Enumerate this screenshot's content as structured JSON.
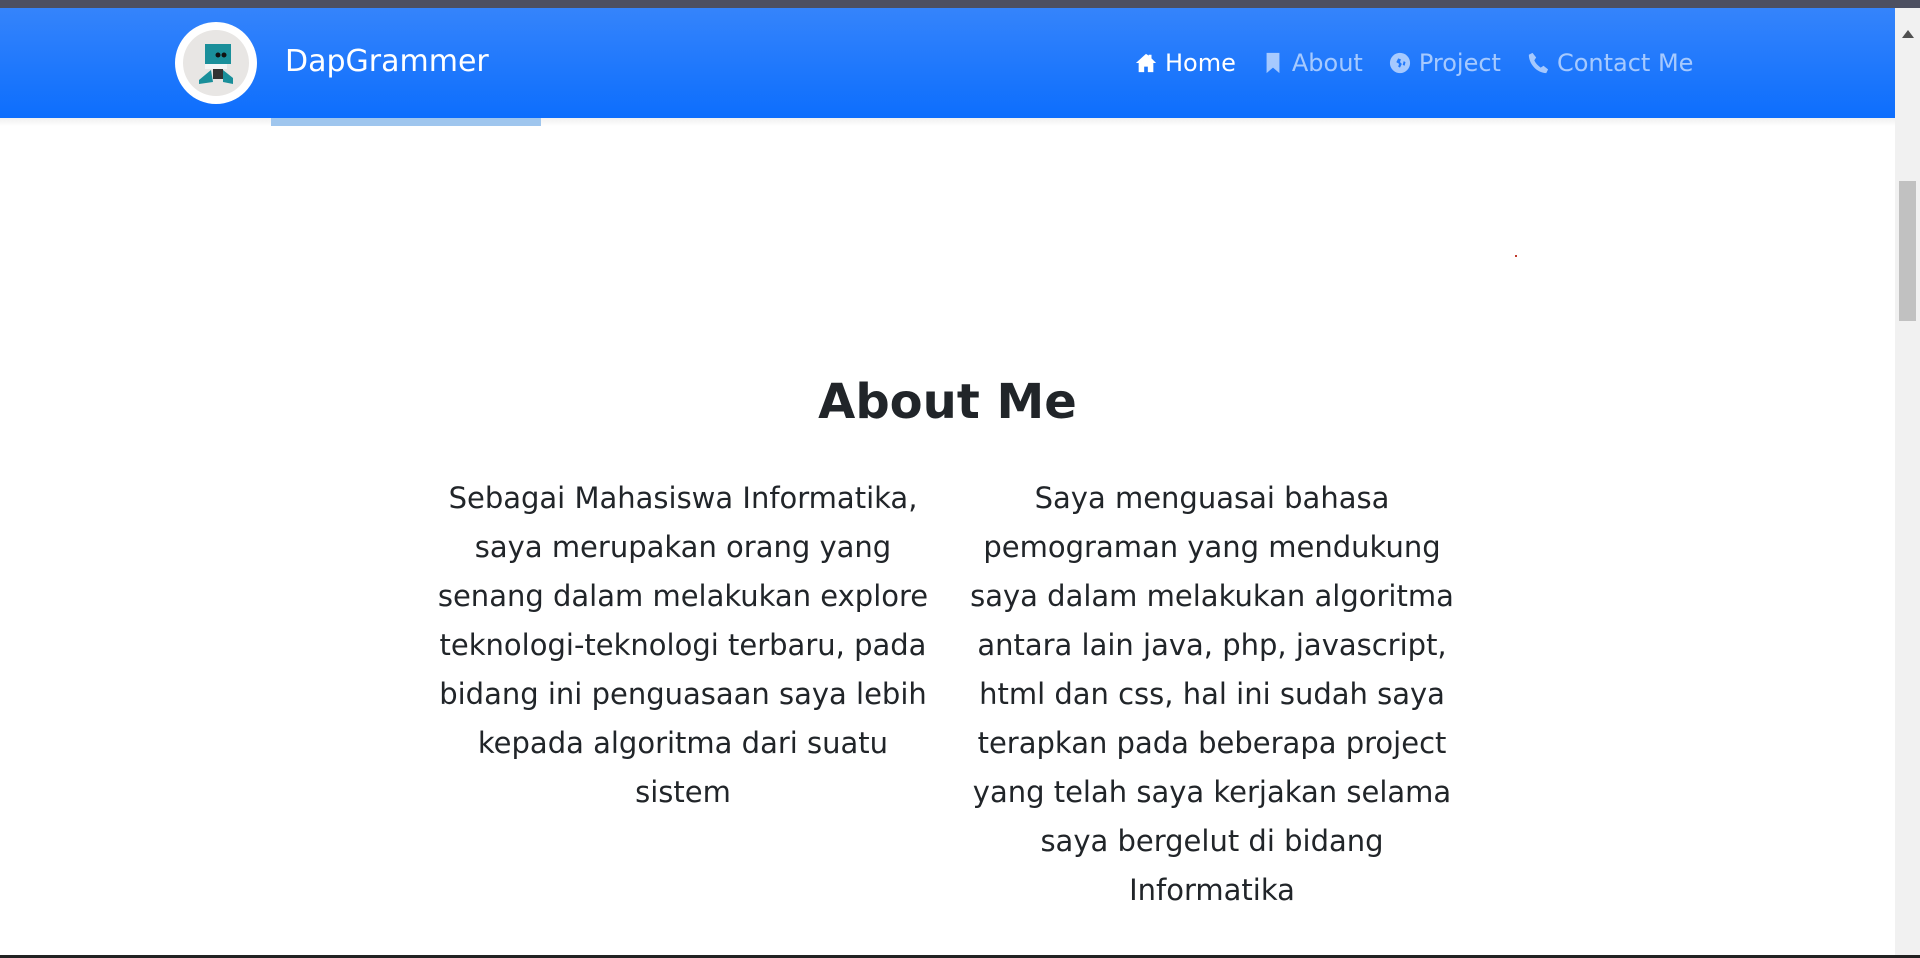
{
  "brand": {
    "name": "DapGrammer"
  },
  "nav": {
    "items": [
      {
        "label": "Home",
        "icon": "home-icon",
        "active": true
      },
      {
        "label": "About",
        "icon": "bookmark-icon",
        "active": false
      },
      {
        "label": "Project",
        "icon": "globe-icon",
        "active": false
      },
      {
        "label": "Contact Me",
        "icon": "phone-icon",
        "active": false
      }
    ]
  },
  "about": {
    "title": "About Me",
    "paragraph_left": "Sebagai Mahasiswa Informatika, saya merupakan orang yang senang dalam melakukan explore teknologi-teknologi terbaru, pada bidang ini penguasaan saya lebih kepada algoritma dari suatu sistem",
    "paragraph_right": "Saya menguasai bahasa pemograman yang mendukung saya dalam melakukan algoritma antara lain java, php, javascript, html dan css, hal ini sudah saya terapkan pada beberapa project yang telah saya kerjakan selama saya bergelut di bidang Informatika"
  },
  "colors": {
    "navbar": "#0d6efd",
    "text": "#212529"
  }
}
